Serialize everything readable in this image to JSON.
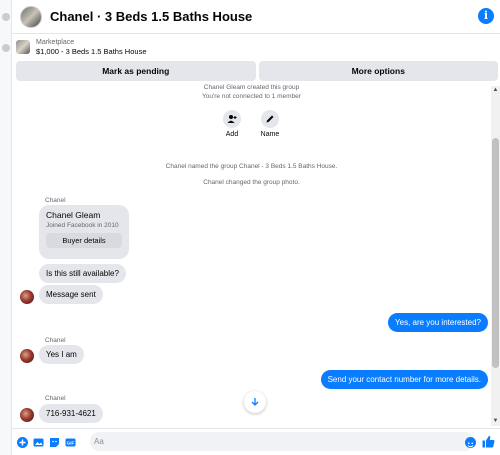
{
  "header": {
    "title": "Chanel · 3 Beds 1.5 Baths House",
    "info_icon": "info-icon"
  },
  "marketplace": {
    "label": "Marketplace",
    "item": "$1,000 - 3 Beds 1.5 Baths House"
  },
  "actions": {
    "mark_pending": "Mark as pending",
    "more_options": "More options"
  },
  "system": {
    "created": "Chanel Gleam created this group",
    "not_connected": "You're not connected to 1 member",
    "renamed": "Chanel named the group Chanel - 3 Beds 1.5 Baths House.",
    "photo": "Chanel changed the group photo."
  },
  "group_actions": {
    "add": "Add",
    "name": "Name"
  },
  "card": {
    "sender": "Chanel",
    "name": "Chanel Gleam",
    "joined": "Joined Facebook in 2010",
    "button": "Buyer details"
  },
  "messages": {
    "available": "Is this still available?",
    "sent": "Message sent",
    "interested": "Yes, are you interested?",
    "sender2": "Chanel",
    "yes": "Yes I am",
    "contact": "Send your contact number for more details.",
    "sender3": "Chanel",
    "phone": "716-931-4621"
  },
  "composer": {
    "placeholder": "Aa"
  },
  "colors": {
    "accent": "#0a7cff",
    "bubble_in": "#e4e6eb"
  }
}
